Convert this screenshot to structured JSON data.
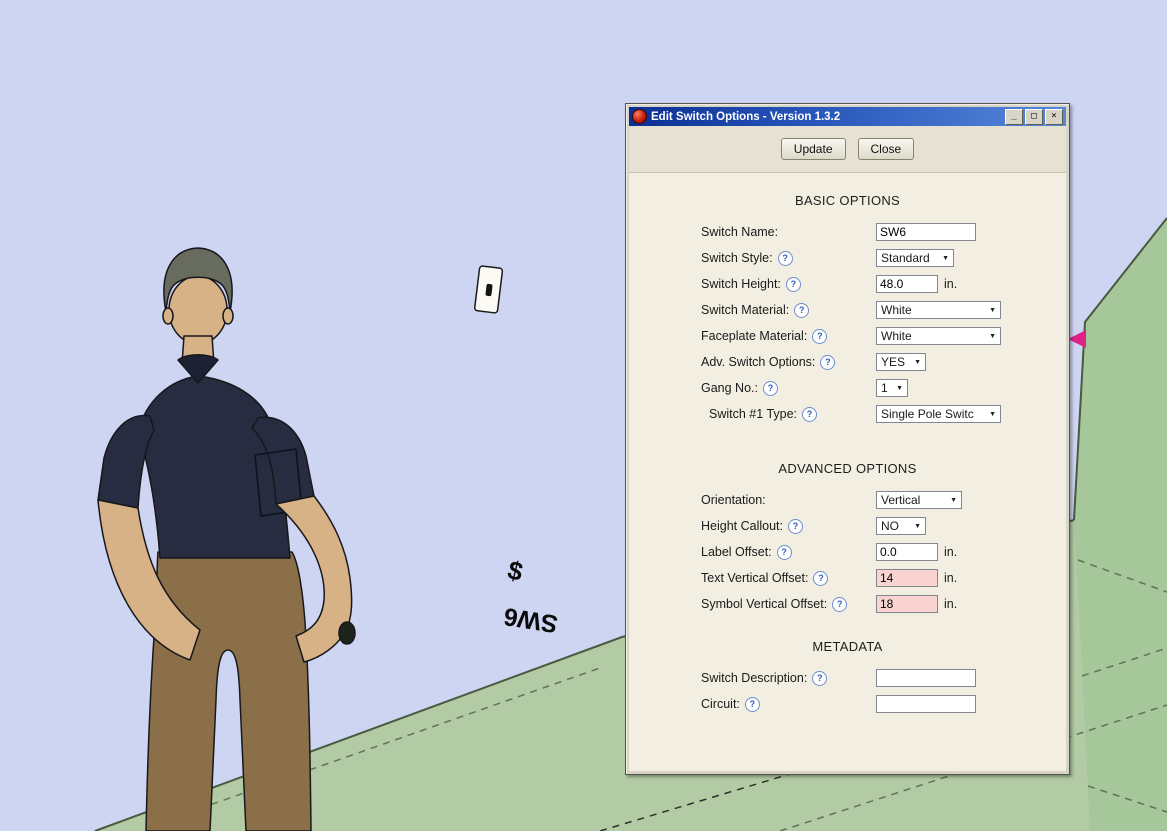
{
  "scene": {
    "wall_color": "#cdd5f3",
    "floor_color": "#b3cba4",
    "right_wall_color": "#a6c79a",
    "edge_color": "#49593f",
    "switch_label": "SW6",
    "switch_symbol": "$",
    "axis_arrow_color": "#e0218a"
  },
  "dialog": {
    "title": "Edit Switch Options - Version 1.3.2",
    "window": {
      "minimize": "_",
      "maximize": "□",
      "close": "×"
    },
    "toolbar": {
      "update_label": "Update",
      "close_label": "Close"
    },
    "help_glyph": "?",
    "select_arrow": "▼",
    "sections": {
      "basic": {
        "heading": "BASIC OPTIONS",
        "rows": [
          {
            "label": "Switch Name:",
            "value": "SW6"
          },
          {
            "label": "Switch Style:",
            "value": "Standard"
          },
          {
            "label": "Switch Height:",
            "value": "48.0",
            "suffix": "in."
          },
          {
            "label": "Switch Material:",
            "value": "White"
          },
          {
            "label": "Faceplate Material:",
            "value": "White"
          },
          {
            "label": "Adv. Switch Options:",
            "value": "YES"
          },
          {
            "label": "Gang No.:",
            "value": "1"
          },
          {
            "label": "Switch #1 Type:",
            "value": "Single Pole Switc"
          }
        ]
      },
      "advanced": {
        "heading": "ADVANCED OPTIONS",
        "rows": [
          {
            "label": "Orientation:",
            "value": "Vertical"
          },
          {
            "label": "Height Callout:",
            "value": "NO"
          },
          {
            "label": "Label Offset:",
            "value": "0.0",
            "suffix": "in."
          },
          {
            "label": "Text Vertical Offset:",
            "value": "14",
            "suffix": "in."
          },
          {
            "label": "Symbol Vertical Offset:",
            "value": "18",
            "suffix": "in."
          }
        ]
      },
      "metadata": {
        "heading": "METADATA",
        "rows": [
          {
            "label": "Switch Description:",
            "value": ""
          },
          {
            "label": "Circuit:",
            "value": ""
          }
        ]
      }
    }
  }
}
